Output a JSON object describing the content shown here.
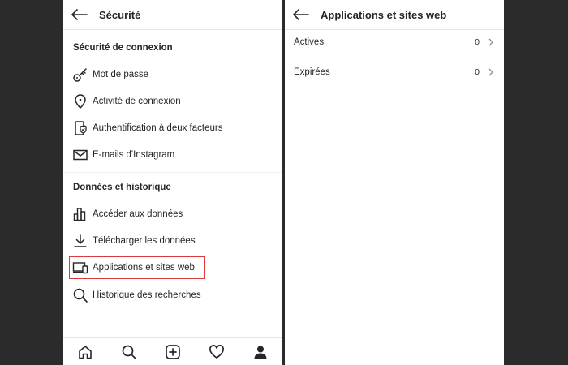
{
  "left": {
    "title": "Sécurité",
    "sections": [
      {
        "title": "Sécurité de connexion",
        "items": [
          {
            "label": "Mot de passe",
            "icon": "key-icon"
          },
          {
            "label": "Activité de connexion",
            "icon": "location-pin-icon"
          },
          {
            "label": "Authentification à deux facteurs",
            "icon": "phone-shield-icon"
          },
          {
            "label": "E-mails d'Instagram",
            "icon": "mail-icon"
          }
        ]
      },
      {
        "title": "Données et historique",
        "items": [
          {
            "label": "Accéder aux données",
            "icon": "bar-chart-icon"
          },
          {
            "label": "Télécharger les données",
            "icon": "download-icon"
          },
          {
            "label": "Applications et sites web",
            "icon": "devices-icon",
            "highlighted": true
          },
          {
            "label": "Historique des recherches",
            "icon": "search-icon"
          }
        ]
      }
    ],
    "bottom_nav": [
      "home-icon",
      "search-icon",
      "add-post-icon",
      "heart-icon",
      "profile-icon"
    ]
  },
  "right": {
    "title": "Applications et sites web",
    "rows": [
      {
        "label": "Actives",
        "count": "0"
      },
      {
        "label": "Expirées",
        "count": "0"
      }
    ]
  },
  "colors": {
    "highlight": "#d93a3a",
    "background": "#2b2b2b",
    "text": "#262626"
  }
}
